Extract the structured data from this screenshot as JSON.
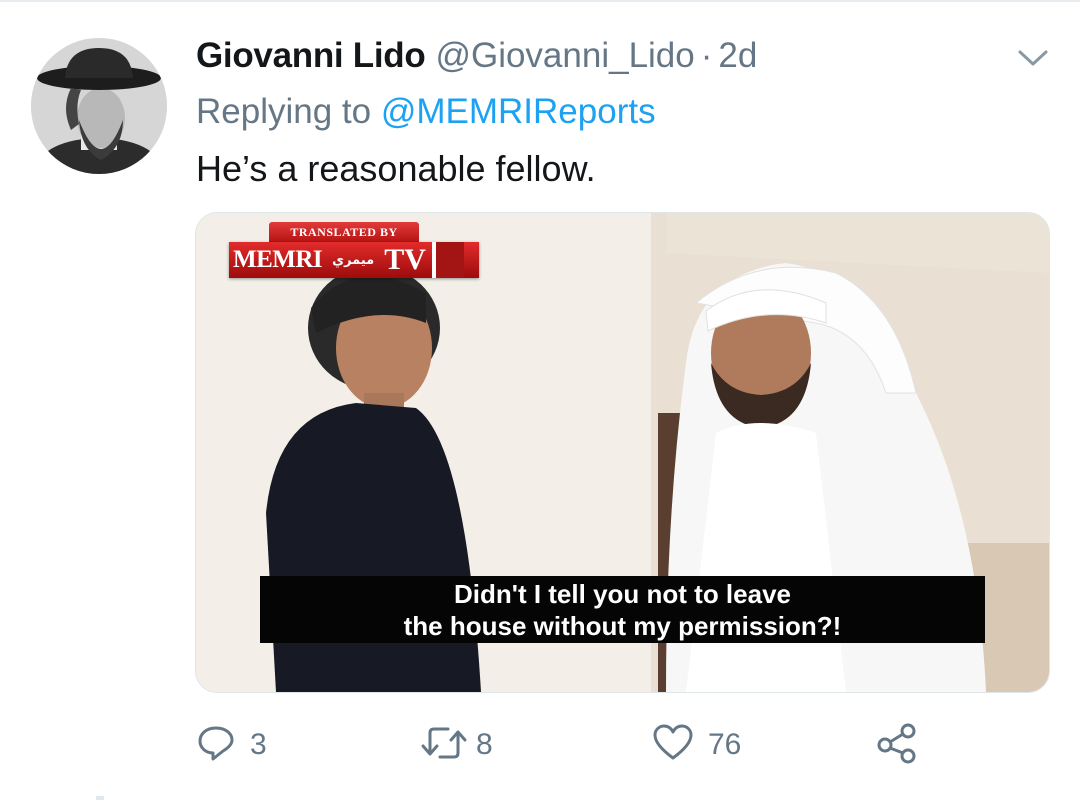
{
  "tweet": {
    "display_name": "Giovanni Lido",
    "handle": "@Giovanni_Lido",
    "separator": "·",
    "time": "2d",
    "replying_prefix": "Replying to",
    "replying_to": "@MEMRIReports",
    "text": "He’s a reasonable fellow.",
    "avatar": "avatar-bearded-man-hat"
  },
  "media": {
    "watermark_top": "TRANSLATED BY",
    "watermark_brand": "MEMRI",
    "watermark_arabic": "ميمري",
    "watermark_tv": "TV",
    "subtitle_line1": "Didn't I tell you not to leave",
    "subtitle_line2": "the house without my permission?!"
  },
  "actions": {
    "reply": {
      "icon": "reply-icon",
      "count": "3"
    },
    "retweet": {
      "icon": "retweet-icon",
      "count": "8"
    },
    "like": {
      "icon": "heart-icon",
      "count": "76"
    },
    "share": {
      "icon": "share-icon"
    }
  },
  "colors": {
    "text": "#14171a",
    "secondary": "#657786",
    "link": "#1da1f2",
    "watermark_red": "#c81818"
  }
}
